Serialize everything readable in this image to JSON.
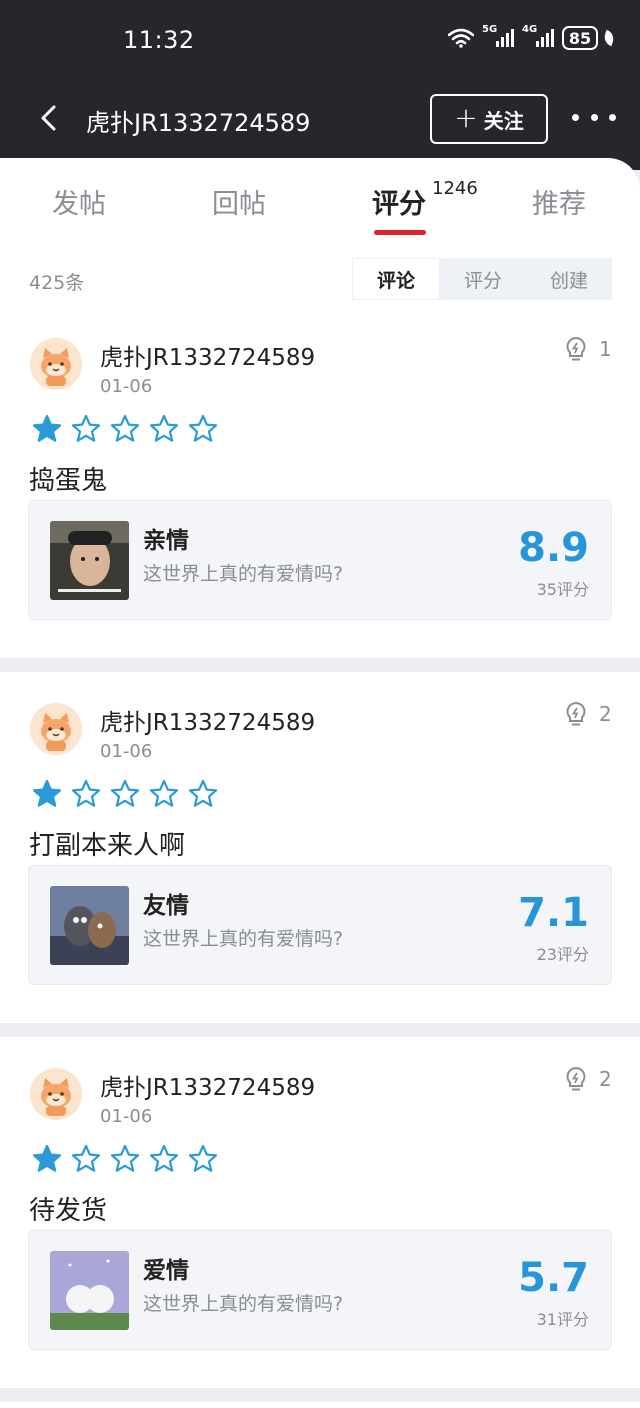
{
  "status": {
    "time": "11:32",
    "net1": "5G",
    "net2": "4G",
    "battery": "85"
  },
  "header": {
    "title": "虎扑JR1332724589",
    "follow_label": "关注"
  },
  "tabs": [
    {
      "label": "发帖"
    },
    {
      "label": "回帖"
    },
    {
      "label": "评分",
      "count": "1246"
    },
    {
      "label": "推荐"
    }
  ],
  "list": {
    "count_text": "425条",
    "segments": [
      "评论",
      "评分",
      "创建"
    ],
    "selected_segment": "评论"
  },
  "colors": {
    "accent_red": "#d8262c",
    "score_blue": "#2796d8",
    "star_blue": "#2b9ad9",
    "header_bg": "#25272c"
  },
  "posts": [
    {
      "user": "虎扑JR1332724589",
      "date": "01-06",
      "lights": "1",
      "rating": 1,
      "text": "捣蛋鬼",
      "card": {
        "title": "亲情",
        "subtitle": "这世界上真的有爱情吗?",
        "score": "8.9",
        "votes": "35评分"
      }
    },
    {
      "user": "虎扑JR1332724589",
      "date": "01-06",
      "lights": "2",
      "rating": 1,
      "text": "打副本来人啊",
      "card": {
        "title": "友情",
        "subtitle": "这世界上真的有爱情吗?",
        "score": "7.1",
        "votes": "23评分"
      }
    },
    {
      "user": "虎扑JR1332724589",
      "date": "01-06",
      "lights": "2",
      "rating": 1,
      "text": "待发货",
      "card": {
        "title": "爱情",
        "subtitle": "这世界上真的有爱情吗?",
        "score": "5.7",
        "votes": "31评分"
      }
    }
  ]
}
